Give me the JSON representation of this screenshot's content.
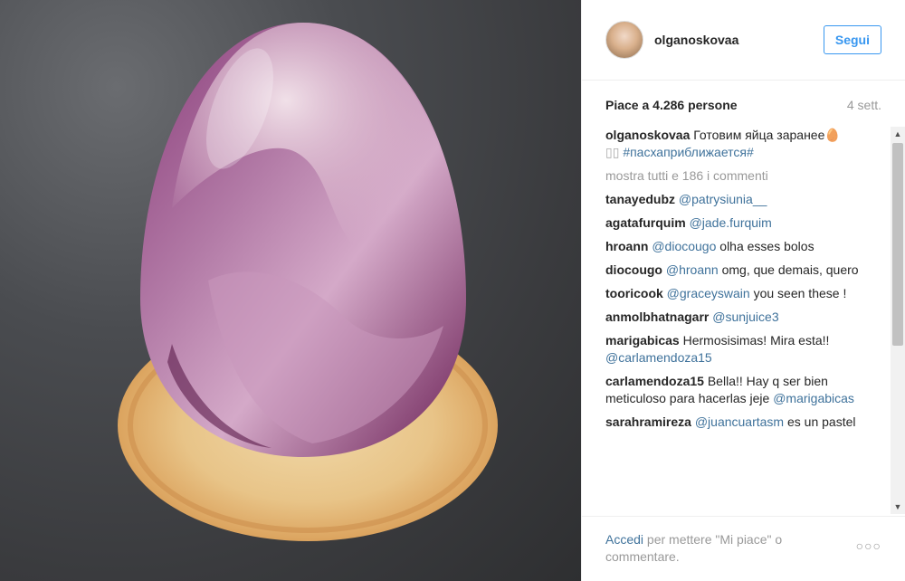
{
  "header": {
    "username": "olganoskovaa",
    "follow_label": "Segui"
  },
  "post": {
    "likes": "Piace a 4.286 persone",
    "age": "4 sett.",
    "caption_user": "olganoskovaa",
    "caption_text": "Готовим яйца заранее🥚",
    "caption_boxes": "▯▯",
    "caption_tag": "#пасхаприближается#",
    "show_all": "mostra tutti e 186 i commenti"
  },
  "comments": [
    {
      "user": "tanayedubz",
      "mention": "@patrysiunia__",
      "text": ""
    },
    {
      "user": "agatafurquim",
      "mention": "@jade.furquim",
      "text": ""
    },
    {
      "user": "hroann",
      "mention": "@diocougo",
      "text": "olha esses bolos"
    },
    {
      "user": "diocougo",
      "mention": "@hroann",
      "text": "omg, que demais, quero"
    },
    {
      "user": "tooricook",
      "mention": "@graceyswain",
      "text": "you seen these !"
    },
    {
      "user": "anmolbhatnagarr",
      "mention": "@sunjuice3",
      "text": ""
    },
    {
      "user": "marigabicas",
      "mention": "",
      "text": "Hermosisimas! Mira esta!!",
      "mention_after": "@carlamendoza15"
    },
    {
      "user": "carlamendoza15",
      "mention": "",
      "text": "Bella!! Hay q ser bien meticuloso para hacerlas jeje",
      "mention_after": "@marigabicas"
    },
    {
      "user": "sarahramireza",
      "mention": "@juancuartasm",
      "text": "es un pastel"
    }
  ],
  "footer": {
    "login": "Accedi",
    "rest": " per mettere \"Mi piace\" o commentare.",
    "more_icon": "ellipsis-icon"
  },
  "colors": {
    "accent": "#3897f0",
    "mention": "#3f729b",
    "muted": "#999999"
  }
}
